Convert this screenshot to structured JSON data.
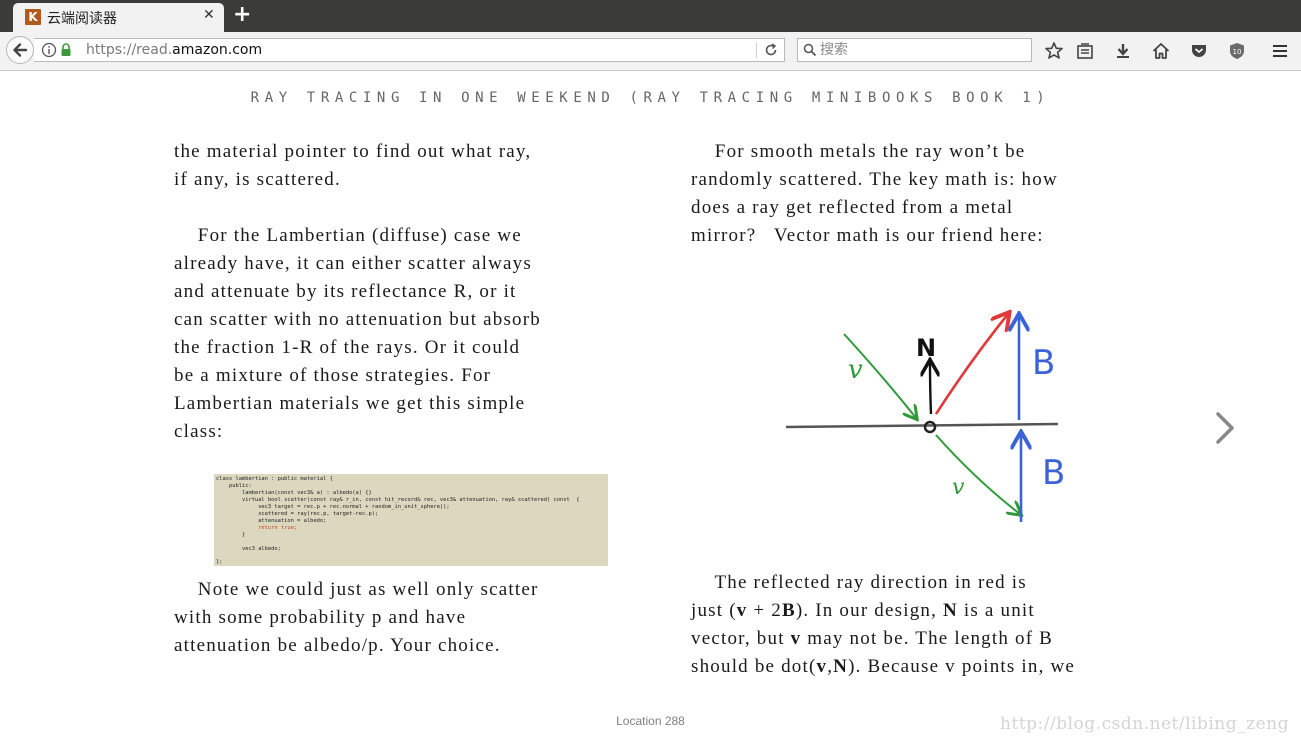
{
  "browser": {
    "tab": {
      "title": "云端阅读器",
      "favicon": "K"
    },
    "address_bar": {
      "url_prefix": "https://read.",
      "url_domain": "amazon.com",
      "url_suffix": ""
    },
    "search": {
      "placeholder": "搜索"
    }
  },
  "reader": {
    "book_title": "RAY TRACING IN ONE WEEKEND (RAY TRACING MINIBOOKS BOOK 1)",
    "left_column": {
      "para1_lines": [
        "the material pointer to find out what ray,",
        "if any, is scattered."
      ],
      "para2_lines": [
        "    For the Lambertian (diffuse) case we",
        "already have, it can either scatter always",
        "and attenuate by its reflectance R, or it",
        "can scatter with no attenuation but absorb",
        "the fraction 1-R of the rays. Or it could",
        "be a mixture of those strategies. For",
        "Lambertian materials we get this simple",
        "class:"
      ],
      "code_lines": [
        "class lambertian : public material {",
        "    public:",
        "        lambertian(const vec3& a) : albedo(a) {}",
        "        virtual bool scatter(const ray& r_in, const hit_record& rec, vec3& attenuation, ray& scattered) const  {",
        "             vec3 target = rec.p + rec.normal + random_in_unit_sphere();",
        "             scattered = ray(rec.p, target-rec.p);",
        "             attenuation = albedo;",
        "             return true;",
        "        }",
        "",
        "        vec3 albedo;",
        "};"
      ],
      "para3_lines": [
        "    Note we could just as well only scatter",
        "with some probability p and have",
        "attenuation be albedo/p. Your choice."
      ]
    },
    "right_column": {
      "para1_lines": [
        "    For smooth metals the ray won’t be",
        "randomly scattered. The key math is: how",
        "does a ray get reflected from a metal",
        "mirror?   Vector math is our friend here:"
      ],
      "diagram_labels": {
        "v_in": "v",
        "normal": "N",
        "b_top": "B",
        "v_out": "v",
        "b_bottom": "B"
      },
      "para2": {
        "l1": "    The reflected ray direction in red is",
        "l2a": "just (",
        "l2b": "v",
        "l2c": " + 2",
        "l2d": "B",
        "l2e": "). In our design, ",
        "l2f": "N",
        "l2g": " is a unit",
        "l3a": "vector, but ",
        "l3b": "v",
        "l3c": " may not be. The length of B",
        "l4a": "should be dot(",
        "l4b": "v",
        "l4c": ",",
        "l4d": "N",
        "l4e": "). Because v points in, we"
      }
    },
    "location": "Location 288",
    "watermark": "http://blog.csdn.net/libing_zeng"
  },
  "colors": {
    "tab_bar": "#3b3b3a",
    "toolbar": "#f2f2f2",
    "code_bg": "#dcd8c0",
    "ray_green": "#2e9a3a",
    "ray_red": "#e03a3a",
    "vector_blue": "#3a63d8"
  }
}
